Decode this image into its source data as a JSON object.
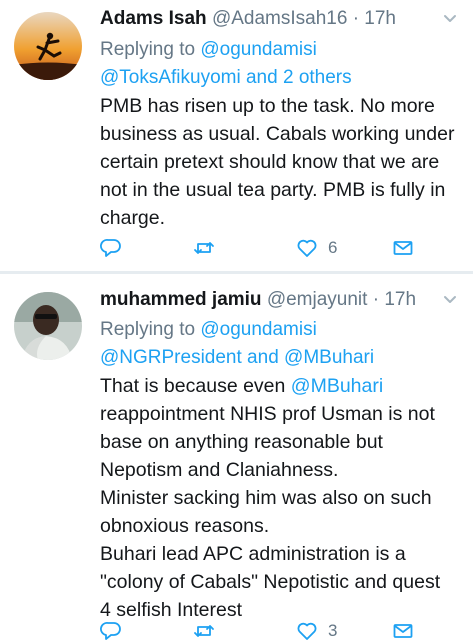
{
  "tweets": [
    {
      "name": "Adams Isah",
      "handle": "@AdamsIsah16",
      "time": "17h",
      "replying_prefix": "Replying to",
      "replying_lines": [
        {
          "mentions": [
            "@ogundamisi"
          ],
          "suffix": ""
        },
        {
          "mentions": [
            "@ToksAfikuyomi and 2 others"
          ],
          "suffix": ""
        }
      ],
      "body_lines": [
        "PMB has risen up to the task. No more",
        "business as usual. Cabals working under",
        "certain pretext should know that we are",
        "not in the usual tea party. PMB is fully in",
        "charge."
      ],
      "likes": "6"
    },
    {
      "name": "muhammed jamiu",
      "handle": "@emjayunit",
      "time": "17h",
      "replying_prefix": "Replying to",
      "replying_lines": [
        {
          "mentions": [
            "@ogundamisi"
          ]
        },
        {
          "mentions": [
            "@NGRPresident and @MBuhari"
          ]
        }
      ],
      "body_lines": [
        {
          "pre": "That is because even ",
          "mention": "@MBuhari",
          "post": ""
        },
        "reappointment NHIS prof Usman is not",
        "base on anything reasonable but",
        "Nepotism and Claniahness.",
        "Minister sacking him was also on such",
        "obnoxious reasons.",
        "Buhari lead APC administration is a",
        "\"colony of Cabals\" Nepotistic and quest",
        "4 selfish Interest"
      ],
      "likes": "3"
    }
  ],
  "icons": {
    "reply": "reply-icon",
    "retweet": "retweet-icon",
    "like": "heart-icon",
    "dm": "envelope-icon",
    "more": "chevron-down-icon"
  },
  "colors": {
    "link": "#1da1f2",
    "secondary": "#657786",
    "divider": "#e6ecf0"
  }
}
